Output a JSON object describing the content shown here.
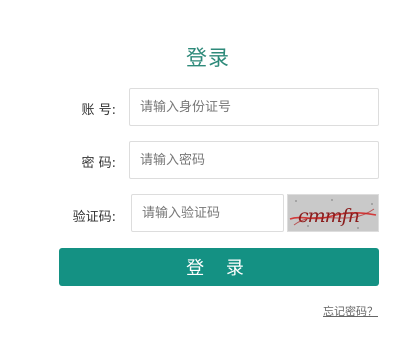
{
  "form": {
    "title": "登录",
    "account": {
      "label": "账 号:",
      "placeholder": "请输入身份证号"
    },
    "password": {
      "label": "密 码:",
      "placeholder": "请输入密码"
    },
    "captcha": {
      "label": "验证码:",
      "placeholder": "请输入验证码",
      "image_text": "cmmfn"
    },
    "login_button": "登 录",
    "forgot_link": "忘记密码？"
  }
}
